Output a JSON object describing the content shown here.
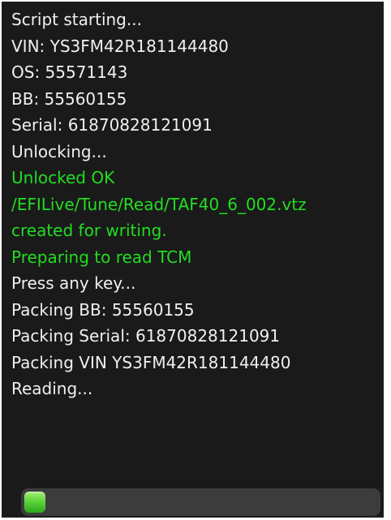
{
  "console": {
    "lines": [
      {
        "text": "Script starting...",
        "color": "#f0f0f0"
      },
      {
        "text": "VIN: YS3FM42R181144480",
        "color": "#f0f0f0"
      },
      {
        "text": "OS: 55571143",
        "color": "#f0f0f0"
      },
      {
        "text": "BB: 55560155",
        "color": "#f0f0f0"
      },
      {
        "text": "Serial: 61870828121091",
        "color": "#f0f0f0"
      },
      {
        "text": "Unlocking...",
        "color": "#f0f0f0"
      },
      {
        "text": "Unlocked OK",
        "color": "#22dd22"
      },
      {
        "text": "/EFILive/Tune/Read/TAF40_6_002.vtz",
        "color": "#22dd22"
      },
      {
        "text": "created for writing.",
        "color": "#22dd22"
      },
      {
        "text": "Preparing to read TCM",
        "color": "#22dd22"
      },
      {
        "text": "Press any key...",
        "color": "#f0f0f0"
      },
      {
        "text": "Packing BB: 55560155",
        "color": "#f0f0f0"
      },
      {
        "text": "Packing Serial: 61870828121091",
        "color": "#f0f0f0"
      },
      {
        "text": "Packing VIN YS3FM42R181144480",
        "color": "#f0f0f0"
      },
      {
        "text": "Reading...",
        "color": "#f0f0f0"
      }
    ]
  },
  "progress": {
    "fraction": 0.05,
    "fill_color": "#44cc2a",
    "track_color": "#3c3c3c"
  }
}
